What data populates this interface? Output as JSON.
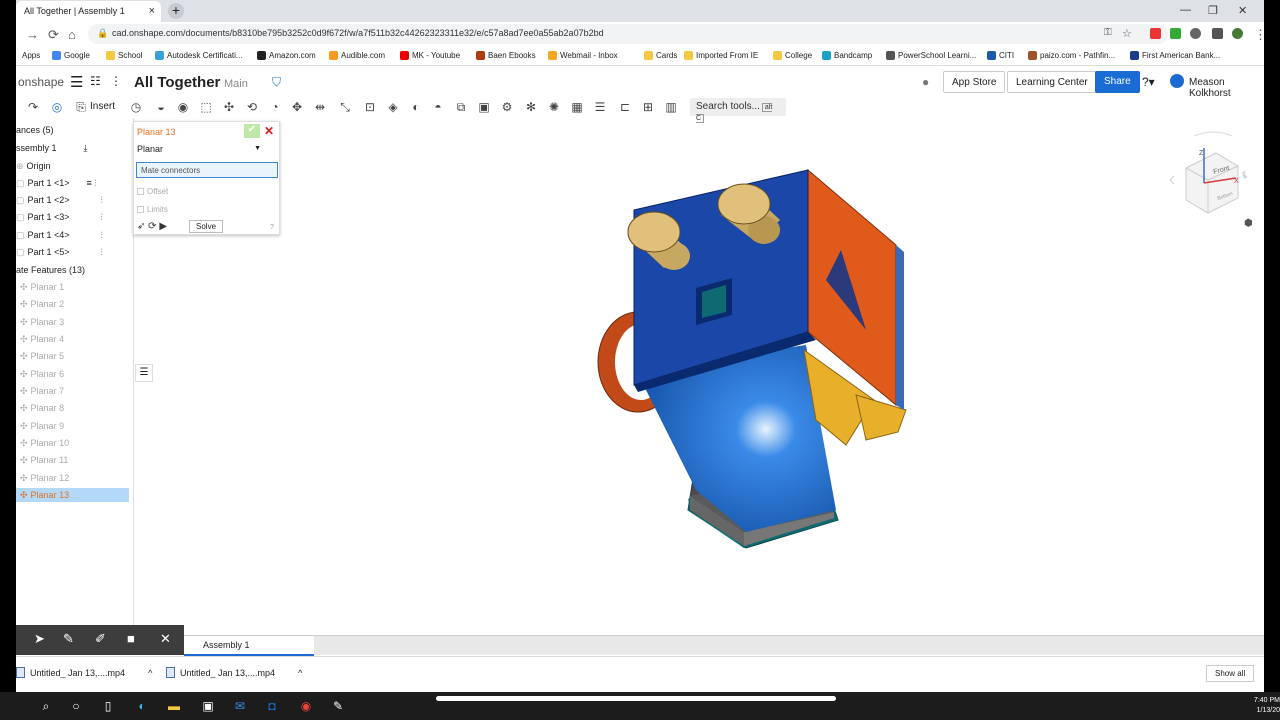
{
  "browser": {
    "tab_title": "All Together | Assembly 1",
    "url": "cad.onshape.com/documents/b8310be795b3252c0d9f672f/w/a7f511b32c44262323311e32/e/c57a8ad7ee0a55ab2a07b2bd",
    "bookmarks": [
      "Apps",
      "Google",
      "School",
      "Autodesk Certificati...",
      "Amazon.com",
      "Audible.com",
      "MK - Youtube",
      "Baen Ebooks",
      "Webmail - Inbox",
      "Cards",
      "Imported From IE",
      "College",
      "Bandcamp",
      "PowerSchool Learni...",
      "CITI",
      "paizo.com - Pathfin...",
      "First American Bank..."
    ]
  },
  "onshape": {
    "logo": "onshape",
    "doc_title": "All Together",
    "branch": "Main",
    "app_store": "App Store",
    "learning_center": "Learning Center",
    "share": "Share",
    "user": "Meason Kolkhorst",
    "insert": "Insert",
    "search_tools": "Search tools...",
    "search_shortcut": "alt C"
  },
  "tree": {
    "instances": "ances (5)",
    "assembly": "ssembly 1",
    "origin": "Origin",
    "parts": [
      "Part 1 <1>",
      "Part 1 <2>",
      "Part 1 <3>",
      "Part 1 <4>",
      "Part 1 <5>"
    ],
    "mate_features": "ate Features (13)",
    "mates": [
      "Planar 1",
      "Planar 2",
      "Planar 3",
      "Planar 4",
      "Planar 5",
      "Planar 6",
      "Planar 7",
      "Planar 8",
      "Planar 9",
      "Planar 10",
      "Planar 11",
      "Planar 12",
      "Planar 13"
    ]
  },
  "mate_dialog": {
    "title": "Planar 13",
    "type": "Planar",
    "connectors": "Mate connectors",
    "offset": "Offset",
    "limits": "Limits",
    "solve": "Solve"
  },
  "viewcube": {
    "front": "Front",
    "top": "Top",
    "bottom": "Bottom"
  },
  "bottom_tab": "Assembly 1",
  "downloads": {
    "items": [
      "Untitled_ Jan 13,....mp4",
      "Untitled_ Jan 13,....mp4"
    ],
    "show_all": "Show all"
  },
  "clock": {
    "time": "7:40 PM",
    "date": "1/13/20"
  }
}
